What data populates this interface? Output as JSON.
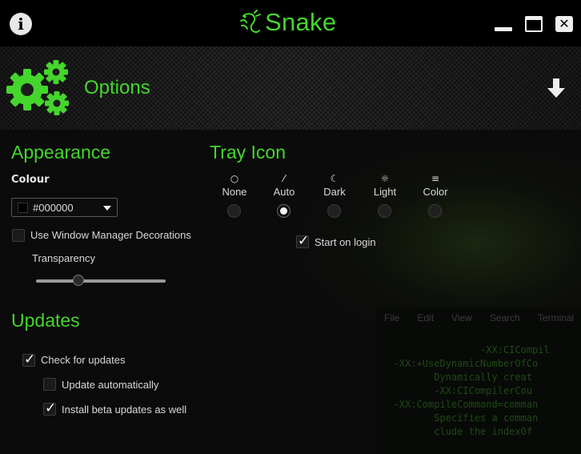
{
  "titlebar": {
    "title": "Snake",
    "info_icon": "info-icon",
    "logo_icon": "razer-snake-logo",
    "minimize_icon": "minimize-icon",
    "maximize_icon": "maximize-icon",
    "close_icon": "close-icon"
  },
  "header": {
    "title": "Options",
    "icon": "gears-icon",
    "action_icon": "down-arrow-icon"
  },
  "colors": {
    "accent": "#44d62c",
    "background": "#000000"
  },
  "appearance": {
    "title": "Appearance",
    "colour_label": "Colour",
    "colour_value": "#000000",
    "wm_decorations_label": "Use Window Manager Decorations",
    "wm_decorations_checked": false,
    "transparency_label": "Transparency",
    "transparency_value": 0.33
  },
  "tray": {
    "title": "Tray Icon",
    "options": [
      {
        "label": "None",
        "icon": "circle-outline-icon",
        "selected": false
      },
      {
        "label": "Auto",
        "icon": "magic-wand-icon",
        "selected": true
      },
      {
        "label": "Dark",
        "icon": "moon-icon",
        "selected": false
      },
      {
        "label": "Light",
        "icon": "sun-icon",
        "selected": false
      },
      {
        "label": "Color",
        "icon": "bars-icon",
        "selected": false
      }
    ],
    "start_on_login_label": "Start on login",
    "start_on_login_checked": true
  },
  "updates": {
    "title": "Updates",
    "check_label": "Check for updates",
    "check_checked": true,
    "auto_label": "Update automatically",
    "auto_checked": false,
    "beta_label": "Install beta updates as well",
    "beta_checked": true
  },
  "background_terminal": {
    "menu": [
      "File",
      "Edit",
      "View",
      "Search",
      "Terminal"
    ],
    "lines": [
      "                  -XX:CICompil",
      "",
      "",
      "   -XX:+UseDynamicNumberOfCo",
      "          Dynamically creat",
      "          -XX:CICompilerCou",
      "",
      "   -XX:CompileCommand=comman",
      "          Specifies a comman",
      "          clude the indexOf"
    ]
  }
}
